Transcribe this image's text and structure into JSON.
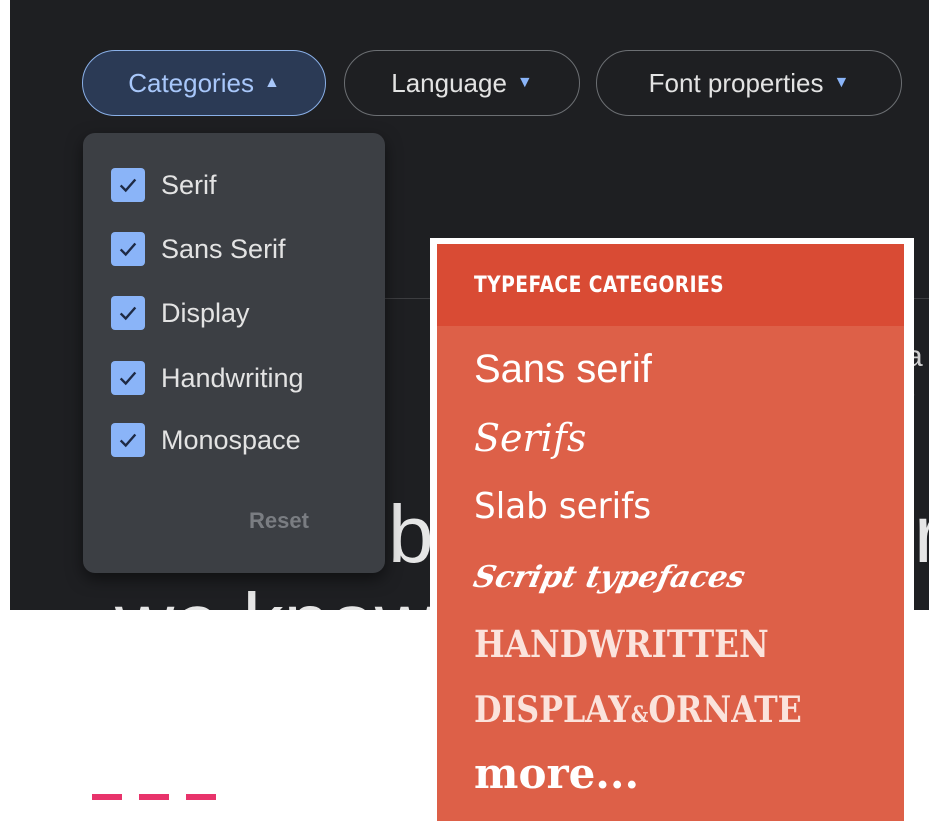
{
  "filters": {
    "categories_label": "Categories",
    "language_label": "Language",
    "font_properties_label": "Font properties"
  },
  "dropdown": {
    "options": [
      "Serif",
      "Sans Serif",
      "Display",
      "Handwriting",
      "Monospace"
    ],
    "reset_label": "Reset"
  },
  "background": {
    "big_letter_1": "b",
    "big_letter_2": "r",
    "line_2": "we know",
    "fragment_1": "a",
    "fragment_2": "/"
  },
  "typeface_panel": {
    "header": "TYPEFACE CATEGORIES",
    "items": {
      "sans": "Sans serif",
      "serifs": "Serifs",
      "slab": "Slab serifs",
      "script": "Script typefaces",
      "handwritten": "HANDWRITTEN",
      "display": "DISPLAY",
      "amp": "&",
      "ornate": "ORNATE",
      "more": "more..."
    }
  },
  "colors": {
    "accent_blue": "#8ab4f8",
    "panel_red": "#dd6048",
    "dash_pink": "#e8336b"
  }
}
